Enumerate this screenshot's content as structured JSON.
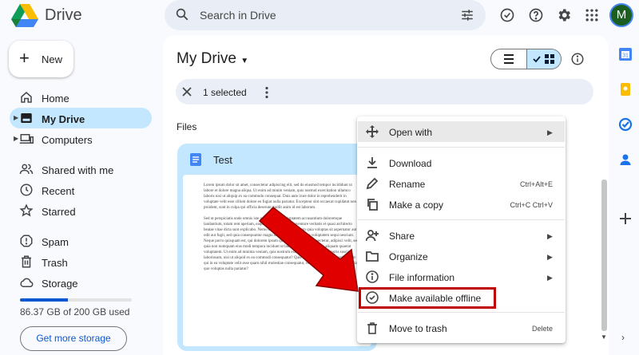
{
  "app": {
    "name": "Drive",
    "brand_color": "#0b57d0"
  },
  "header": {
    "search_placeholder": "Search in Drive",
    "avatar_initial": "M"
  },
  "sidebar": {
    "new_label": "New",
    "items": [
      {
        "label": "Home",
        "icon": "home-icon"
      },
      {
        "label": "My Drive",
        "icon": "my-drive-icon",
        "active": true
      },
      {
        "label": "Computers",
        "icon": "computer-icon"
      },
      {
        "label": "Shared with me",
        "icon": "people-icon"
      },
      {
        "label": "Recent",
        "icon": "clock-icon"
      },
      {
        "label": "Starred",
        "icon": "star-icon"
      },
      {
        "label": "Spam",
        "icon": "spam-icon"
      },
      {
        "label": "Trash",
        "icon": "trash-icon"
      },
      {
        "label": "Storage",
        "icon": "cloud-icon"
      }
    ],
    "storage_used_text": "86.37 GB of 200 GB used",
    "storage_fraction": 0.43,
    "get_storage_label": "Get more storage"
  },
  "main": {
    "title": "My Drive",
    "selection_text": "1 selected",
    "section_label": "Files",
    "file": {
      "name": "Test",
      "preview_paragraphs": [
        "Lorem ipsum dolor sit amet, consectetur adipiscing elit, sed do eiusmod tempor incididunt ut labore et dolore magna aliqua. Ut enim ad minim veniam, quis nostrud exercitation ullamco laboris nisi ut aliquip ex ea commodo consequat. Duis aute irure dolor in reprehenderit in voluptate velit esse cillum dolore eu fugiat nulla pariatur. Excepteur sint occaecat cupidatat non proident, sunt in culpa qui officia deserunt mollit anim id est laborum.",
        "Sed ut perspiciatis unde omnis iste natus error sit voluptatem accusantium doloremque laudantium, totam rem aperiam, eaque ipsa quae ab illo inventore veritatis et quasi architecto beatae vitae dicta sunt explicabo. Nemo enim ipsam voluptatem quia voluptas sit aspernatur aut odit aut fugit, sed quia consequuntur magni dolores eos qui ratione voluptatem sequi nesciunt. Neque porro quisquam est, qui dolorem ipsum quia dolor sit amet, consectetur, adipisci velit, sed quia non numquam eius modi tempora incidunt ut labore et dolore magnam aliquam quaerat voluptatem. Ut enim ad minima veniam, quis nostrum exercitationem ullam corporis suscipit laboriosam, nisi ut aliquid ex ea commodi consequatur? Quis autem vel eum iure reprehenderit qui in ea voluptate velit esse quam nihil molestiae consequatur, vel illum qui dolorem eum fugiat quo voluptas nulla pariatur?"
      ]
    }
  },
  "context_menu": {
    "items": [
      {
        "label": "Open with",
        "icon": "open-with-icon",
        "submenu": true,
        "shortcut": ""
      },
      {
        "label": "Download",
        "icon": "download-icon",
        "submenu": false,
        "shortcut": ""
      },
      {
        "label": "Rename",
        "icon": "pencil-icon",
        "submenu": false,
        "shortcut": "Ctrl+Alt+E"
      },
      {
        "label": "Make a copy",
        "icon": "copy-icon",
        "submenu": false,
        "shortcut": "Ctrl+C Ctrl+V"
      },
      {
        "label": "Share",
        "icon": "share-icon",
        "submenu": true,
        "shortcut": ""
      },
      {
        "label": "Organize",
        "icon": "folder-icon",
        "submenu": true,
        "shortcut": ""
      },
      {
        "label": "File information",
        "icon": "info-icon",
        "submenu": true,
        "shortcut": ""
      },
      {
        "label": "Make available offline",
        "icon": "offline-icon",
        "submenu": false,
        "shortcut": ""
      },
      {
        "label": "Move to trash",
        "icon": "trash-icon",
        "submenu": false,
        "shortcut": "Delete"
      }
    ]
  },
  "colors": {
    "accent": "#0b57d0",
    "selected_bg": "#c2e7ff",
    "annotation_red": "#e00000"
  }
}
